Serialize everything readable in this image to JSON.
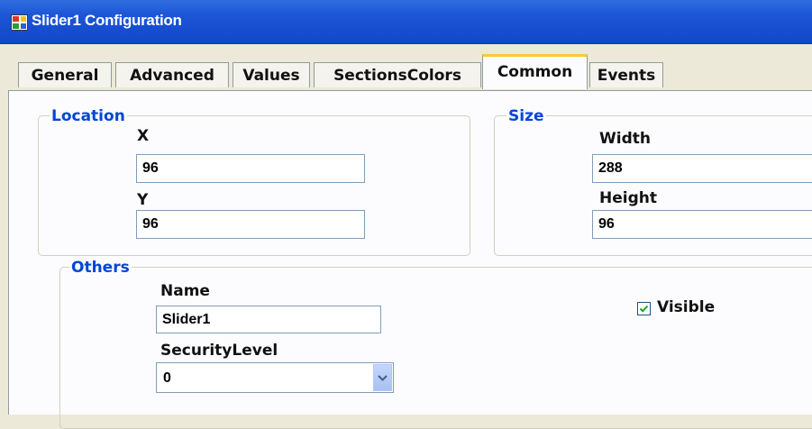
{
  "window": {
    "title": "Slider1 Configuration"
  },
  "tabs": [
    "General",
    "Advanced",
    "Values",
    "SectionsColors",
    "Common",
    "Events"
  ],
  "active_tab": "Common",
  "location": {
    "title": "Location",
    "x_label": "X",
    "x_value": "96",
    "y_label": "Y",
    "y_value": "96"
  },
  "size": {
    "title": "Size",
    "width_label": "Width",
    "width_value": "288",
    "height_label": "Height",
    "height_value": "96"
  },
  "others": {
    "title": "Others",
    "name_label": "Name",
    "name_value": "Slider1",
    "security_label": "SecurityLevel",
    "security_value": "0",
    "visible_label": "Visible",
    "visible_checked": true
  },
  "colors": {
    "accent": "#0046d5",
    "titlebar": "#1c55d6",
    "tab_highlight": "#ffc83c"
  }
}
